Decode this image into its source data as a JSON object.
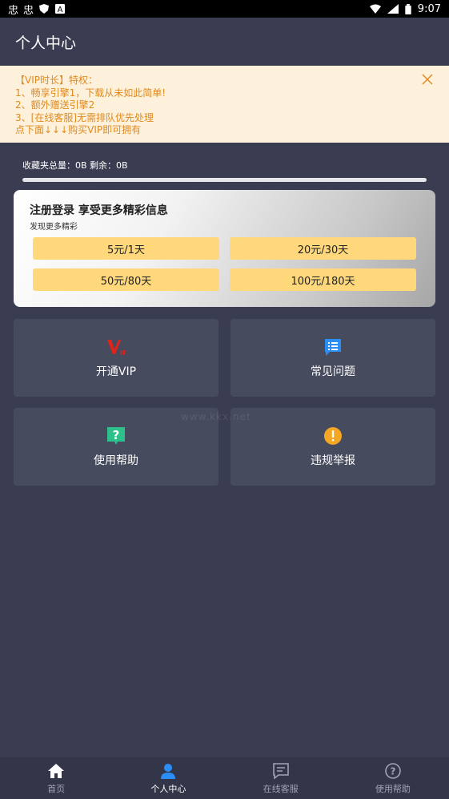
{
  "status_bar": {
    "left_icons": [
      "app-notification-icon",
      "app-notification-icon",
      "shield-icon",
      "a-icon"
    ],
    "time": "9:07"
  },
  "header": {
    "title": "个人中心"
  },
  "notice": {
    "lines": [
      "【VIP时长】特权：",
      "1、畅享引擎1，下载从未如此简单!",
      "2、额外赠送引擎2",
      "3、[在线客服]无需排队优先处理",
      "点下面↓↓↓购买VIP即可拥有"
    ]
  },
  "storage": {
    "text": "收藏夹总量：0B 剩余：0B"
  },
  "promo": {
    "title": "注册登录 享受更多精彩信息",
    "subtitle": "发现更多精彩",
    "prices": [
      "5元/1天",
      "20元/30天",
      "50元/80天",
      "100元/180天"
    ]
  },
  "tiles": [
    {
      "label": "开通VIP",
      "icon": "vip-icon",
      "color": "#e2231a"
    },
    {
      "label": "常见问题",
      "icon": "faq-icon",
      "color": "#2b8ef7"
    },
    {
      "label": "使用帮助",
      "icon": "help-icon",
      "color": "#2ec08a"
    },
    {
      "label": "违规举报",
      "icon": "warning-icon",
      "color": "#f5a623"
    }
  ],
  "watermark": "www.kkx.net",
  "bottom_nav": {
    "items": [
      {
        "label": "首页",
        "icon": "home-icon"
      },
      {
        "label": "个人中心",
        "icon": "user-icon"
      },
      {
        "label": "在线客服",
        "icon": "chat-icon"
      },
      {
        "label": "使用帮助",
        "icon": "question-icon"
      }
    ],
    "active_index": 1
  },
  "colors": {
    "background": "#3a3d52",
    "notice_bg": "#fdf1dc",
    "notice_text": "#e08a1f",
    "price_button": "#fed87b",
    "active_nav": "#2b8ef7"
  }
}
